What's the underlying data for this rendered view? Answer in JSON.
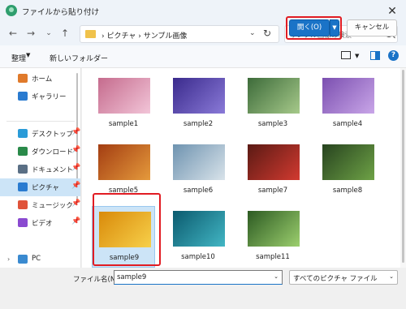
{
  "window": {
    "title": "ファイルから貼り付け",
    "close_glyph": "✕"
  },
  "nav": {
    "back_glyph": "←",
    "forward_glyph": "→",
    "dropdown_glyph": "⌄",
    "up_glyph": "↑",
    "address": "›  ピクチャ  ›  サンプル画像",
    "address_chevron": "⌄",
    "refresh_glyph": "↻",
    "search_placeholder": "サンプル画像の検索"
  },
  "command_bar": {
    "organize": "整理",
    "organize_caret": "▼",
    "new_folder": "新しいフォルダー",
    "view_caret": "▼",
    "help_glyph": "?"
  },
  "sidebar": {
    "items": [
      {
        "label": "ホーム",
        "icon": "home-icon",
        "pinned": false
      },
      {
        "label": "ギャラリー",
        "icon": "gallery-icon",
        "pinned": false
      },
      {
        "label": "デスクトップ",
        "icon": "desktop-icon",
        "pinned": true
      },
      {
        "label": "ダウンロード",
        "icon": "download-icon",
        "pinned": true
      },
      {
        "label": "ドキュメント",
        "icon": "documents-icon",
        "pinned": true
      },
      {
        "label": "ピクチャ",
        "icon": "pictures-icon",
        "pinned": true,
        "selected": true
      },
      {
        "label": "ミュージック",
        "icon": "music-icon",
        "pinned": true
      },
      {
        "label": "ビデオ",
        "icon": "video-icon",
        "pinned": true
      },
      {
        "label": "PC",
        "icon": "pc-icon",
        "pinned": false
      }
    ],
    "pin_glyph": "📌",
    "expand_glyph": "›"
  },
  "files": [
    {
      "name": "sample1",
      "colors": [
        "#c56b8d",
        "#f2c5d8"
      ]
    },
    {
      "name": "sample2",
      "colors": [
        "#3a2a8c",
        "#8a7ad8"
      ]
    },
    {
      "name": "sample3",
      "colors": [
        "#3d6b3a",
        "#a6c98a"
      ]
    },
    {
      "name": "sample4",
      "colors": [
        "#7b4fb0",
        "#c9a6e8"
      ]
    },
    {
      "name": "sample5",
      "colors": [
        "#a33d12",
        "#e59a3c"
      ]
    },
    {
      "name": "sample6",
      "colors": [
        "#6e93b0",
        "#d9e3ea"
      ]
    },
    {
      "name": "sample7",
      "colors": [
        "#5a1a14",
        "#d23a30"
      ]
    },
    {
      "name": "sample8",
      "colors": [
        "#27431f",
        "#6ea246"
      ]
    },
    {
      "name": "sample9",
      "colors": [
        "#d98a0a",
        "#f7d04a"
      ],
      "selected": true
    },
    {
      "name": "sample10",
      "colors": [
        "#0b5a6e",
        "#42b6c4"
      ]
    },
    {
      "name": "sample11",
      "colors": [
        "#2c5a22",
        "#9ccf6e"
      ]
    }
  ],
  "bottom": {
    "filename_label": "ファイル名(N):",
    "filename_value": "sample9",
    "dropdown_caret": "⌄",
    "filter_value": "すべてのピクチャ ファイル",
    "open_label": "開く(O)",
    "open_split_glyph": "▼",
    "cancel_label": "キャンセル"
  },
  "colors": {
    "accent": "#1a73c7",
    "highlight": "#e11c23",
    "selection": "#cce4f7"
  }
}
